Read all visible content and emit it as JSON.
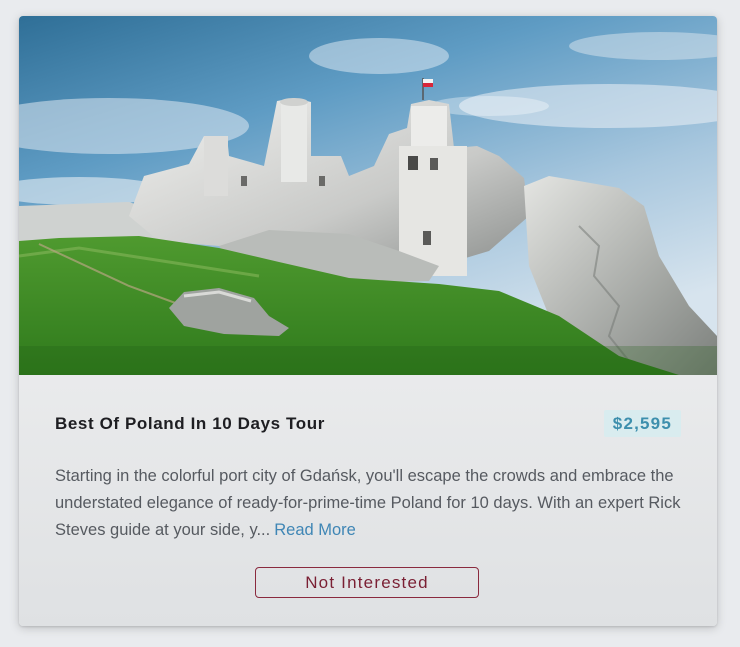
{
  "card": {
    "image": {
      "alt_icon": "castle-photo"
    },
    "title": "Best Of Poland In 10 Days Tour",
    "price": "$2,595",
    "description": "Starting in the colorful port city of Gdańsk, you'll escape the crowds and embrace the understated elegance of ready-for-prime-time Poland for 10 days. With an expert Rick Steves guide at your side, y...",
    "read_more": "Read More",
    "dismiss_label": "Not Interested"
  },
  "colors": {
    "price_text": "#3d8fad",
    "price_bg": "#d9ecef",
    "link": "#3f86b5",
    "dismiss": "#7a1f33"
  }
}
